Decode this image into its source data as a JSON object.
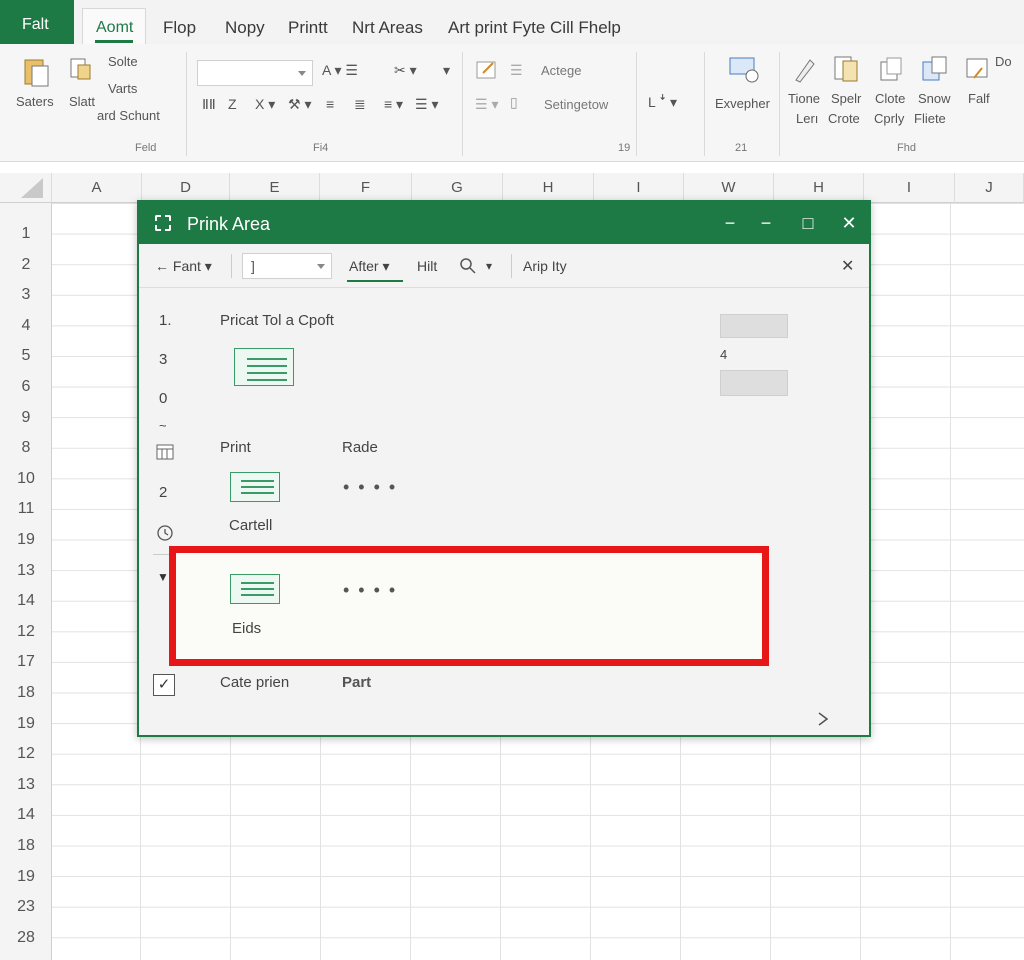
{
  "tabs": {
    "file": "Falt",
    "active": "Aomt",
    "items": [
      "Flop",
      "Nopy",
      "Printt",
      "Nrt Areas",
      "Art print Fyte Cill Fhelp"
    ]
  },
  "ribbon": {
    "clipboard": {
      "paste": "Saters",
      "style": "Slatt",
      "solte": "Solte",
      "warts": "Varts",
      "schunt": "ard Schunt",
      "group": "Feld"
    },
    "font": {
      "group": "Fi4"
    },
    "align": {
      "actege": "Actege",
      "settings": "Setingetow",
      "group": "19"
    },
    "exp": {
      "label": "Exvepher",
      "group": "21"
    },
    "tools": {
      "labels": [
        "Tione",
        "Spelr",
        "Clote",
        "Snow",
        "Falf"
      ],
      "labels2": [
        "Lerı",
        "Crote",
        "Cprly",
        "Fliete"
      ],
      "do": "Do",
      "group": "Fhd"
    }
  },
  "grid": {
    "columns": [
      "A",
      "D",
      "E",
      "F",
      "G",
      "H",
      "I",
      "W",
      "H",
      "I",
      "J"
    ],
    "rows": [
      "1",
      "2",
      "3",
      "4",
      "5",
      "6",
      "9",
      "8",
      "10",
      "11",
      "19",
      "13",
      "14",
      "12",
      "17",
      "18",
      "19",
      "12",
      "13",
      "14",
      "18",
      "19",
      "23",
      "28"
    ]
  },
  "dialog": {
    "title": "Prink Area",
    "toolbar": {
      "font": "← Fant",
      "field_value": "]",
      "after": "After",
      "hilt": "Hilt",
      "arip": "Arip Ity"
    },
    "body": {
      "numbers": [
        "1.",
        "3",
        "0",
        "2"
      ],
      "heading": "Pricat Tol a Cpoft",
      "side_number": "4",
      "print_label": "Print",
      "rade_label": "Rade",
      "dots": "• • • •",
      "cartell": "Cartell",
      "eids": "Eids",
      "cate_label": "Cate prien",
      "part_label": "Part",
      "check_mark": "✓",
      "tilde": "~"
    },
    "highlight_color": "#e81717",
    "accent_color": "#1e7a45"
  }
}
